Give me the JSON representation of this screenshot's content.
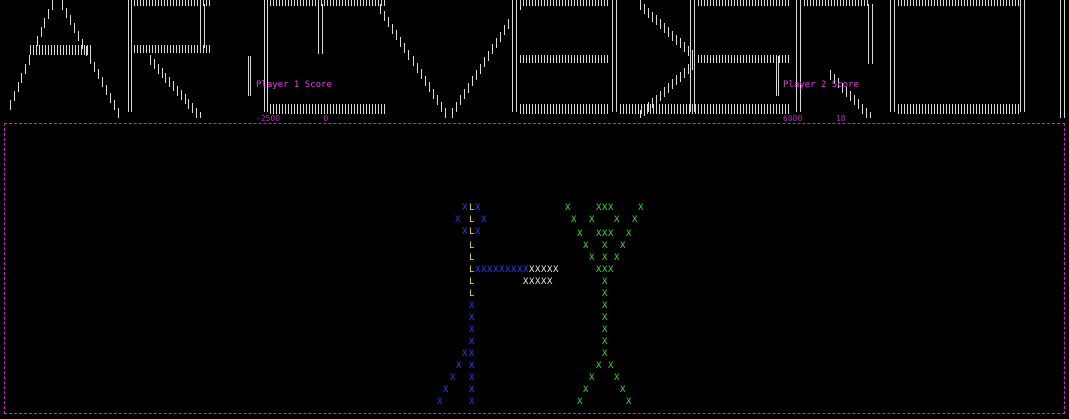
{
  "game": {
    "title_word": "ARRIVEDERCI",
    "player1": {
      "label": "Player 1 Score",
      "score": "-2500",
      "extra": "0"
    },
    "player2": {
      "label": "Player 2 Score",
      "score": "6000",
      "extra": "18"
    },
    "colors": {
      "banner": "#d8d8d8",
      "score_label": "#e040e0",
      "arena_border": "#d020d0",
      "player1_body": "#2a3cf0",
      "player1_weapon": "#f0e020",
      "player2_body": "#30e030",
      "projectile": "#e8e8e8"
    },
    "characters": {
      "player1_glyph": "X",
      "weapon_glyph": "L",
      "player2_glyph": "X",
      "projectile_glyph": "X"
    }
  }
}
